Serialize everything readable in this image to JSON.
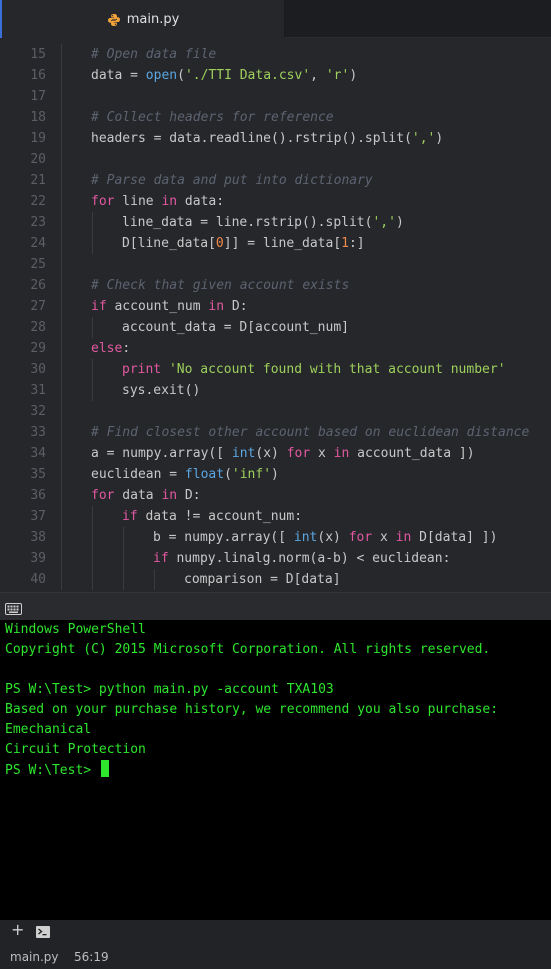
{
  "tab": {
    "label": "main.py",
    "icon": "python-file-icon"
  },
  "editor": {
    "lines": [
      {
        "n": "15",
        "indent": 1,
        "parts": [
          [
            "cm",
            "# Open data file"
          ]
        ]
      },
      {
        "n": "16",
        "indent": 1,
        "parts": [
          [
            "pl",
            "data = "
          ],
          [
            "fn",
            "open"
          ],
          [
            "pl",
            "("
          ],
          [
            "st",
            "'./TTI Data.csv'"
          ],
          [
            "pl",
            ", "
          ],
          [
            "st",
            "'r'"
          ],
          [
            "pl",
            ")"
          ]
        ]
      },
      {
        "n": "17",
        "indent": 1,
        "parts": []
      },
      {
        "n": "18",
        "indent": 1,
        "parts": [
          [
            "cm",
            "# Collect headers for reference"
          ]
        ]
      },
      {
        "n": "19",
        "indent": 1,
        "parts": [
          [
            "pl",
            "headers = data.readline().rstrip().split("
          ],
          [
            "st",
            "','"
          ],
          [
            "pl",
            ")"
          ]
        ]
      },
      {
        "n": "20",
        "indent": 1,
        "parts": []
      },
      {
        "n": "21",
        "indent": 1,
        "parts": [
          [
            "cm",
            "# Parse data and put into dictionary"
          ]
        ]
      },
      {
        "n": "22",
        "indent": 1,
        "parts": [
          [
            "kw",
            "for"
          ],
          [
            "pl",
            " line "
          ],
          [
            "kw",
            "in"
          ],
          [
            "pl",
            " data:"
          ]
        ]
      },
      {
        "n": "23",
        "indent": 2,
        "parts": [
          [
            "pl",
            "line_data = line.rstrip().split("
          ],
          [
            "st",
            "','"
          ],
          [
            "pl",
            ")"
          ]
        ]
      },
      {
        "n": "24",
        "indent": 2,
        "parts": [
          [
            "pl",
            "D[line_data["
          ],
          [
            "nu",
            "0"
          ],
          [
            "pl",
            "]] = line_data["
          ],
          [
            "nu",
            "1"
          ],
          [
            "pl",
            ":]"
          ]
        ]
      },
      {
        "n": "25",
        "indent": 1,
        "parts": []
      },
      {
        "n": "26",
        "indent": 1,
        "parts": [
          [
            "cm",
            "# Check that given account exists"
          ]
        ]
      },
      {
        "n": "27",
        "indent": 1,
        "parts": [
          [
            "kw",
            "if"
          ],
          [
            "pl",
            " account_num "
          ],
          [
            "kw",
            "in"
          ],
          [
            "pl",
            " D:"
          ]
        ]
      },
      {
        "n": "28",
        "indent": 2,
        "parts": [
          [
            "pl",
            "account_data = D[account_num]"
          ]
        ]
      },
      {
        "n": "29",
        "indent": 1,
        "parts": [
          [
            "kw",
            "else"
          ],
          [
            "pl",
            ":"
          ]
        ]
      },
      {
        "n": "30",
        "indent": 2,
        "parts": [
          [
            "kw",
            "print"
          ],
          [
            "pl",
            " "
          ],
          [
            "st",
            "'No account found with that account number'"
          ]
        ]
      },
      {
        "n": "31",
        "indent": 2,
        "parts": [
          [
            "pl",
            "sys.exit()"
          ]
        ]
      },
      {
        "n": "32",
        "indent": 1,
        "parts": []
      },
      {
        "n": "33",
        "indent": 1,
        "parts": [
          [
            "cm",
            "# Find closest other account based on euclidean distance"
          ]
        ]
      },
      {
        "n": "34",
        "indent": 1,
        "parts": [
          [
            "pl",
            "a = numpy.array([ "
          ],
          [
            "fn",
            "int"
          ],
          [
            "pl",
            "(x) "
          ],
          [
            "kw",
            "for"
          ],
          [
            "pl",
            " x "
          ],
          [
            "kw",
            "in"
          ],
          [
            "pl",
            " account_data ])"
          ]
        ]
      },
      {
        "n": "35",
        "indent": 1,
        "parts": [
          [
            "pl",
            "euclidean = "
          ],
          [
            "fn",
            "float"
          ],
          [
            "pl",
            "("
          ],
          [
            "st",
            "'inf'"
          ],
          [
            "pl",
            ")"
          ]
        ]
      },
      {
        "n": "36",
        "indent": 1,
        "parts": [
          [
            "kw",
            "for"
          ],
          [
            "pl",
            " data "
          ],
          [
            "kw",
            "in"
          ],
          [
            "pl",
            " D:"
          ]
        ]
      },
      {
        "n": "37",
        "indent": 2,
        "parts": [
          [
            "kw",
            "if"
          ],
          [
            "pl",
            " data != account_num:"
          ]
        ]
      },
      {
        "n": "38",
        "indent": 3,
        "parts": [
          [
            "pl",
            "b = numpy.array([ "
          ],
          [
            "fn",
            "int"
          ],
          [
            "pl",
            "(x) "
          ],
          [
            "kw",
            "for"
          ],
          [
            "pl",
            " x "
          ],
          [
            "kw",
            "in"
          ],
          [
            "pl",
            " D[data] ])"
          ]
        ]
      },
      {
        "n": "39",
        "indent": 3,
        "parts": [
          [
            "kw",
            "if"
          ],
          [
            "pl",
            " numpy.linalg.norm(a-b) < euclidean:"
          ]
        ]
      },
      {
        "n": "40",
        "indent": 4,
        "parts": [
          [
            "pl",
            "comparison = D[data]"
          ]
        ]
      }
    ]
  },
  "terminal": {
    "lines": [
      "Windows PowerShell",
      "Copyright (C) 2015 Microsoft Corporation. All rights reserved.",
      "",
      "PS W:\\Test> python main.py -account TXA103",
      "Based on your purchase history, we recommend you also purchase:",
      "Emechanical",
      "Circuit Protection"
    ],
    "prompt": "PS W:\\Test> "
  },
  "statusbar": {
    "file": "main.py",
    "position": "56:19"
  },
  "colors": {
    "accent": "#3b6fd8",
    "keyword": "#e158a0",
    "function": "#5ba6e0",
    "string": "#9ed05c",
    "number": "#f08a4a",
    "comment": "#5c6370",
    "terminal_text": "#2ee62e"
  }
}
